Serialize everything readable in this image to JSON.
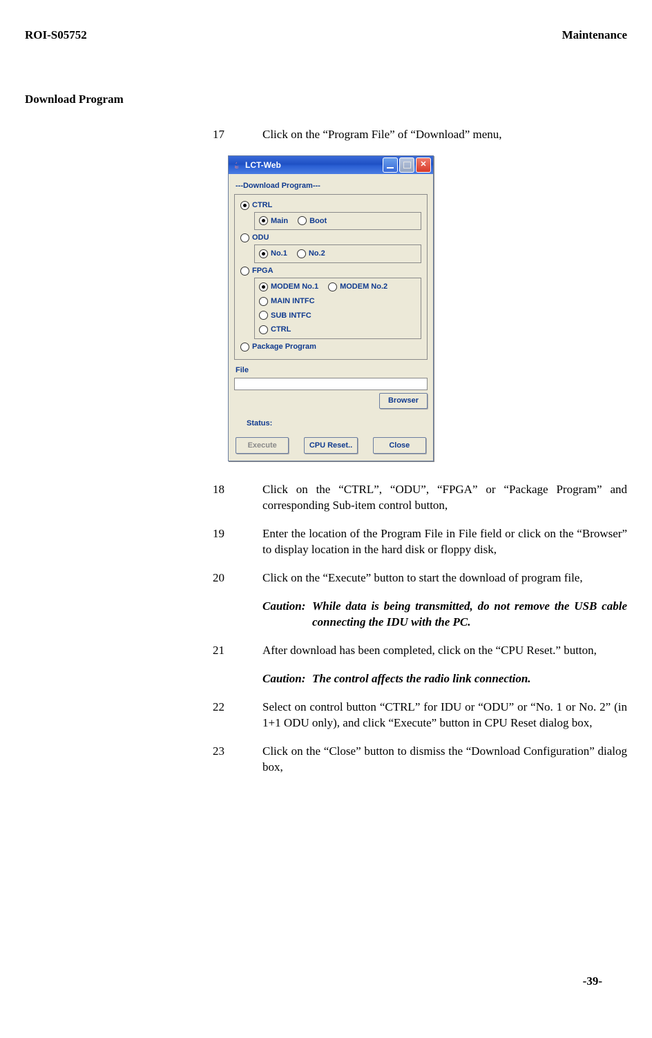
{
  "header": {
    "left": "ROI-S05752",
    "right": "Maintenance"
  },
  "section_title": "Download Program",
  "steps": {
    "s17": {
      "n": "17",
      "t": "Click on the “Program File” of “Download” menu,"
    },
    "s18": {
      "n": "18",
      "t": "Click on the “CTRL”, “ODU”, “FPGA” or “Package Program” and corresponding Sub-item control button,"
    },
    "s19": {
      "n": "19",
      "t": "Enter the location of the Program File in File field or click on the “Browser” to display location in the hard disk or floppy disk,"
    },
    "s20": {
      "n": "20",
      "t": "Click on the “Execute” button to start the download of program file,"
    },
    "c20": {
      "label": "Caution:",
      "body": "While data is being transmitted, do not remove the USB cable connecting the IDU with the PC."
    },
    "s21": {
      "n": "21",
      "t": "After download has been completed, click on the “CPU Reset.” button,"
    },
    "c21": {
      "label": "Caution:",
      "body": "The control affects the radio link connection."
    },
    "s22": {
      "n": "22",
      "t": "Select on control button “CTRL” for IDU or “ODU” or “No. 1 or No. 2” (in 1+1 ODU only), and click “Execute” button in CPU Reset dialog box,"
    },
    "s23": {
      "n": "23",
      "t": "Click on the “Close” button to dismiss the “Download Configuration” dialog box,"
    }
  },
  "dialog": {
    "title": "LCT-Web",
    "group_title": "---Download Program---",
    "ctrl": {
      "label": "CTRL",
      "main": "Main",
      "boot": "Boot"
    },
    "odu": {
      "label": "ODU",
      "no1": "No.1",
      "no2": "No.2"
    },
    "fpga": {
      "label": "FPGA",
      "m1": "MODEM No.1",
      "m2": "MODEM No.2",
      "mi": "MAIN INTFC",
      "si": "SUB INTFC",
      "ct": "CTRL"
    },
    "pkg": "Package Program",
    "file_label": "File",
    "browser": "Browser",
    "status": "Status:",
    "btn_exec": "Execute",
    "btn_cpu": "CPU Reset..",
    "btn_close": "Close"
  },
  "page_number": "-39-"
}
